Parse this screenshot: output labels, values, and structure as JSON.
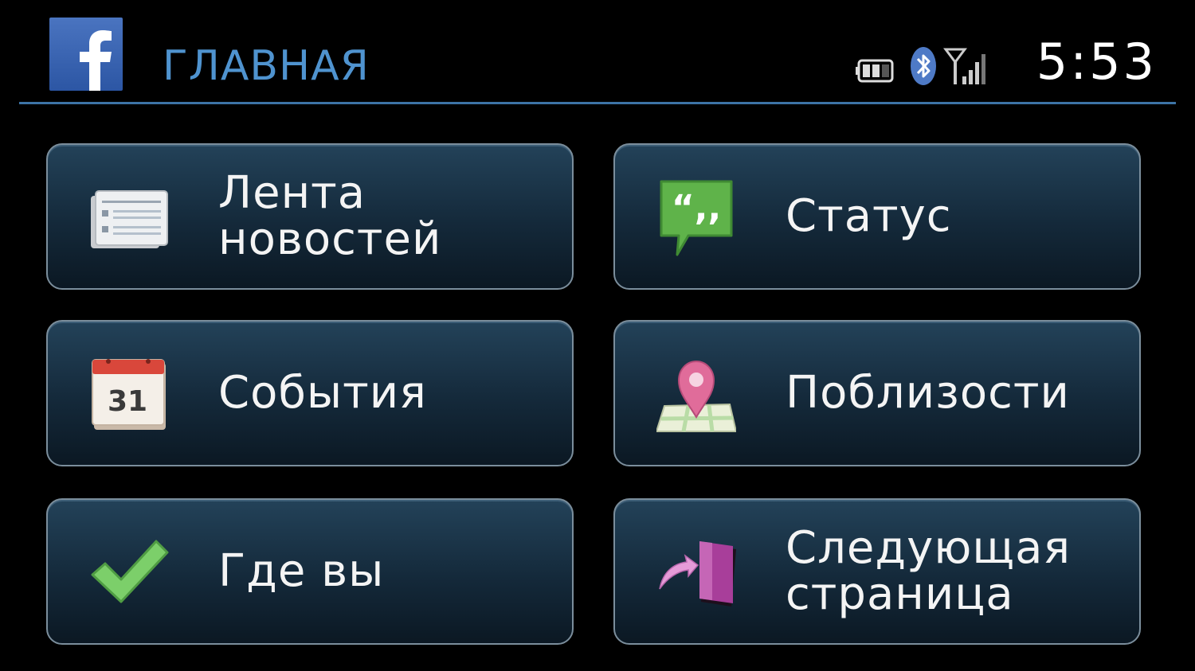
{
  "header": {
    "app_logo_letter": "f",
    "title": "ГЛАВНАЯ",
    "clock": "5:53",
    "status_icons": [
      "battery-icon",
      "bluetooth-icon",
      "signal-icon"
    ]
  },
  "colors": {
    "title": "#4f93cf",
    "header_rule": "#3d74a6",
    "tile_border": "#7b8e9c",
    "facebook_blue": "#3b5fad"
  },
  "tiles": [
    {
      "label": "Лента\nновостей",
      "icon": "newspaper-icon"
    },
    {
      "label": "Статус",
      "icon": "quote-bubble-icon"
    },
    {
      "label": "События",
      "icon": "calendar-icon",
      "icon_text": "31"
    },
    {
      "label": "Поблизости",
      "icon": "map-pin-icon"
    },
    {
      "label": "Где вы",
      "icon": "checkmark-icon"
    },
    {
      "label": "Следующая\nстраница",
      "icon": "next-page-icon"
    }
  ]
}
